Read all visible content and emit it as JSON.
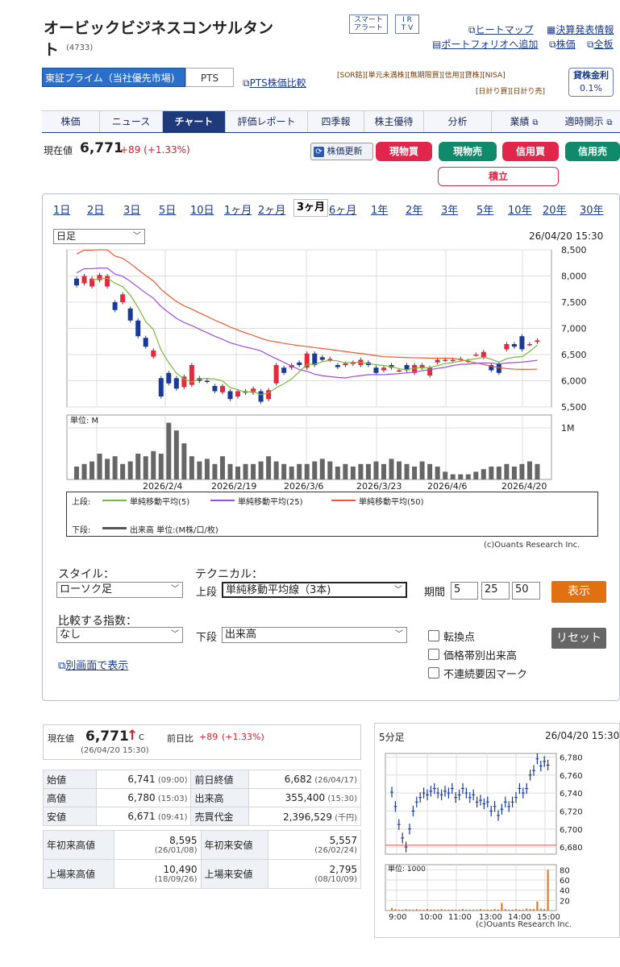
{
  "header": {
    "company": "オービックビジネスコンサルタン",
    "company2": "ト",
    "code": "(4733)",
    "btn_smart1": "スマート",
    "btn_smart2": "アラート",
    "btn_ir1": "I R",
    "btn_ir2": "T V",
    "heatmap": "ヒートマップ",
    "earnings_info": "決算発表情報",
    "portfolio_add": "ポートフォリオへ追加",
    "stock_price": "株価",
    "all_boards": "全板"
  },
  "market": {
    "selected": "東証プライム（当社優先市場)",
    "pts": "PTS",
    "pts_compare": "PTS株価比較"
  },
  "tags": {
    "row1": [
      "[SOR銘]",
      "[単元未満株]",
      "[無期限買]",
      "[信用]",
      "[貸株]",
      "[NISA]"
    ],
    "row2": [
      "[日計り買]",
      "[日計り売]"
    ]
  },
  "lending": {
    "label": "貸株金利",
    "value": "0.1%"
  },
  "nav": [
    "株価",
    "ニュース",
    "チャート",
    "評価レポート",
    "四季報",
    "株主優待",
    "分析"
  ],
  "nav_right": {
    "results": "業績",
    "disclosure": "適時開示"
  },
  "price": {
    "label": "現在値",
    "value": "6,771",
    "change": "+89 (+1.33%)"
  },
  "actions": {
    "refresh": "株価更新",
    "buy": "現物買",
    "sell": "現物売",
    "margin_buy": "信用買",
    "margin_sell": "信用売",
    "accumulate": "積立"
  },
  "periods": [
    "1日",
    "2日",
    "3日",
    "5日",
    "10日",
    "1ヶ月",
    "2ヶ月",
    "3ヶ月",
    "6ヶ月",
    "1年",
    "2年",
    "3年",
    "5年",
    "10年",
    "20年",
    "30年"
  ],
  "chart_head": {
    "interval": "日足",
    "datetime": "26/04/20 15:30",
    "unit": "単位: M",
    "vol_tick": "1M",
    "credit": "(c)Ouants Research Inc."
  },
  "legend": {
    "upper": "上段:",
    "ma5": "単純移動平均(5)",
    "ma25": "単純移動平均(25)",
    "ma50": "単純移動平均(50)",
    "lower": "下段:",
    "volume": "出来高 単位:(M株/口/枚)"
  },
  "controls": {
    "style_label": "スタイル：",
    "style_value": "ローソク足",
    "tech_label": "テクニカル：",
    "upper_label": "上段",
    "upper_value": "単純移動平均線（3本)",
    "period_label": "期間",
    "p1": "5",
    "p2": "25",
    "p3": "50",
    "show": "表示",
    "compare_label": "比較する指数：",
    "compare_value": "なし",
    "lower_label": "下段",
    "lower_value": "出来高",
    "reset": "リセット",
    "cb1": "転換点",
    "cb2": "価格帯別出来高",
    "cb3": "不連続要因マーク",
    "open_window": "別画面で表示"
  },
  "quote": {
    "label": "現在値",
    "value": "6,771",
    "arrow": "↑",
    "c": "C",
    "time": "(26/04/20 15:30)",
    "prev_label": "前日比",
    "prev_value": "+89",
    "prev_pct": "(+1.33%)",
    "rows": [
      [
        "始値",
        "6,741",
        "(09:00)",
        "前日終値",
        "6,682",
        "(26/04/17)"
      ],
      [
        "高値",
        "6,780",
        "(15:03)",
        "出来高",
        "355,400",
        "(15:30)"
      ],
      [
        "安値",
        "6,671",
        "(09:41)",
        "売買代金",
        "2,396,529",
        "(千円)"
      ]
    ],
    "yr": [
      [
        "年初来高値",
        "8,595",
        "(26/01/08)",
        "年初来安値",
        "5,557",
        "(26/02/24)"
      ],
      [
        "上場来高値",
        "10,490",
        "(18/09/26)",
        "上場来安値",
        "2,795",
        "(08/10/09)"
      ]
    ]
  },
  "mini": {
    "title": "5分足",
    "datetime": "26/04/20 15:30",
    "unit": "単位: 1000",
    "credit": "(c)Ouants Research Inc."
  },
  "chart_data": [
    {
      "type": "candlestick",
      "title": "日足",
      "x": [
        "2026/2/4",
        "2026/2/19",
        "2026/3/6",
        "2026/3/23",
        "2026/4/6",
        "2026/4/20"
      ],
      "ylim": [
        5500,
        8500
      ],
      "yticks": [
        5500,
        6000,
        6500,
        7000,
        7500,
        8000,
        8500
      ],
      "candles": [
        [
          7950,
          7820
        ],
        [
          7860,
          8000
        ],
        [
          7800,
          7950
        ],
        [
          7920,
          8020
        ],
        [
          7800,
          8000
        ],
        [
          7500,
          7350
        ],
        [
          7500,
          7650
        ],
        [
          7380,
          7150
        ],
        [
          7150,
          6850
        ],
        [
          6820,
          6650
        ],
        [
          6460,
          6580
        ],
        [
          6050,
          5700
        ],
        [
          6150,
          5950
        ],
        [
          6050,
          5850
        ],
        [
          5880,
          6080
        ],
        [
          5920,
          6300
        ],
        [
          6050,
          6000
        ],
        [
          6000,
          5990
        ],
        [
          5900,
          5800
        ],
        [
          5780,
          5900
        ],
        [
          5800,
          5650
        ],
        [
          5700,
          5800
        ],
        [
          5800,
          5770
        ],
        [
          5770,
          5850
        ],
        [
          5800,
          5600
        ],
        [
          5650,
          5820
        ],
        [
          5950,
          6300
        ],
        [
          6250,
          6150
        ],
        [
          6250,
          6300
        ],
        [
          6350,
          6300
        ],
        [
          6250,
          6520
        ],
        [
          6520,
          6300
        ],
        [
          6450,
          6400
        ],
        [
          6400,
          6420
        ],
        [
          6300,
          6260
        ],
        [
          6300,
          6330
        ],
        [
          6320,
          6350
        ],
        [
          6300,
          6400
        ],
        [
          6350,
          6300
        ],
        [
          6250,
          6150
        ],
        [
          6200,
          6250
        ],
        [
          6300,
          6250
        ],
        [
          6200,
          6200
        ],
        [
          6300,
          6200
        ],
        [
          6150,
          6300
        ],
        [
          6250,
          6300
        ],
        [
          6100,
          6250
        ],
        [
          6350,
          6400
        ],
        [
          6400,
          6400
        ],
        [
          6380,
          6400
        ],
        [
          6420,
          6420
        ],
        [
          6380,
          6380
        ],
        [
          6500,
          6500
        ],
        [
          6450,
          6550
        ],
        [
          6300,
          6200
        ],
        [
          6320,
          6150
        ],
        [
          6600,
          6700
        ],
        [
          6700,
          6650
        ],
        [
          6850,
          6600
        ],
        [
          6700,
          6700
        ],
        [
          6741,
          6771
        ]
      ],
      "series": [
        {
          "name": "単純移動平均(5)"
        },
        {
          "name": "単純移動平均(25)"
        },
        {
          "name": "単純移動平均(50)"
        }
      ]
    },
    {
      "type": "bar",
      "title": "出来高",
      "unit": "M",
      "x": [
        "2026/2/4",
        "2026/2/19",
        "2026/3/6",
        "2026/3/23",
        "2026/4/6",
        "2026/4/20"
      ],
      "values": [
        0.25,
        0.3,
        0.35,
        0.5,
        0.4,
        0.45,
        0.3,
        0.35,
        0.5,
        0.45,
        0.55,
        0.5,
        1.1,
        0.95,
        0.7,
        0.45,
        0.35,
        0.4,
        0.3,
        0.45,
        0.3,
        0.25,
        0.3,
        0.3,
        0.35,
        0.45,
        0.35,
        0.3,
        0.25,
        0.3,
        0.3,
        0.35,
        0.4,
        0.35,
        0.25,
        0.3,
        0.25,
        0.3,
        0.3,
        0.35,
        0.3,
        0.4,
        0.35,
        0.3,
        0.25,
        0.35,
        0.3,
        0.25,
        0.15,
        0.1,
        0.1,
        0.1,
        0.15,
        0.2,
        0.25,
        0.25,
        0.3,
        0.25,
        0.3,
        0.35,
        0.3
      ],
      "yticks": [
        1
      ]
    },
    {
      "type": "line",
      "title": "5分足",
      "x": [
        "9:00",
        "10:00",
        "11:00",
        "13:00",
        "14:00",
        "15:00"
      ],
      "ylim": [
        6680,
        6780
      ],
      "yticks": [
        6680,
        6700,
        6720,
        6740,
        6760,
        6780
      ],
      "values": [
        6741,
        6725,
        6705,
        6690,
        6680,
        6700,
        6720,
        6730,
        6735,
        6740,
        6738,
        6742,
        6745,
        6740,
        6738,
        6742,
        6740,
        6745,
        6735,
        6738,
        6745,
        6740,
        6735,
        6738,
        6730,
        6732,
        6728,
        6730,
        6720,
        6725,
        6715,
        6722,
        6730,
        6725,
        6730,
        6735,
        6745,
        6740,
        6745,
        6760,
        6765,
        6778,
        6770,
        6775,
        6771
      ]
    },
    {
      "type": "bar",
      "title": "5分足出来高",
      "unit": "1000",
      "yticks": [
        20,
        40,
        60,
        80
      ],
      "values": [
        5,
        3,
        2,
        2,
        3,
        2,
        2,
        3,
        2,
        2,
        3,
        2,
        2,
        2,
        3,
        2,
        2,
        2,
        2,
        2,
        3,
        2,
        2,
        2,
        2,
        3,
        2,
        2,
        2,
        3,
        2,
        15,
        3,
        2,
        2,
        3,
        2,
        2,
        4,
        3,
        3,
        18,
        4,
        3,
        80
      ]
    }
  ]
}
